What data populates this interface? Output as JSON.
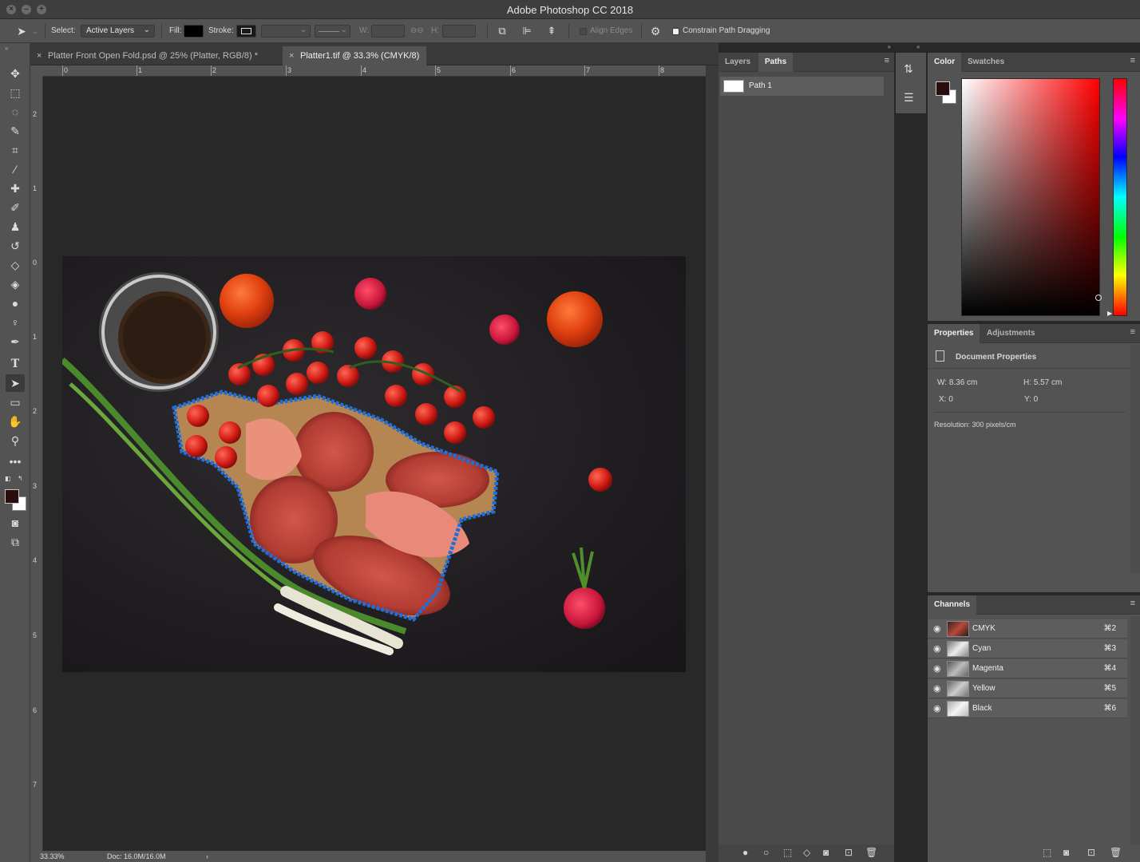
{
  "window": {
    "title": "Adobe Photoshop CC 2018"
  },
  "options_bar": {
    "select_label": "Select:",
    "select_value": "Active Layers",
    "fill_label": "Fill:",
    "stroke_label": "Stroke:",
    "w_label": "W:",
    "h_label": "H:",
    "align_edges_label": "Align Edges",
    "constrain_label": "Constrain Path Dragging"
  },
  "tabs": [
    {
      "label": "Platter Front Open Fold.psd @ 25% (Platter, RGB/8) *",
      "active": false
    },
    {
      "label": "Platter1.tif @ 33.3% (CMYK/8)",
      "active": true
    }
  ],
  "rulers": {
    "top_labels": [
      "0",
      "1",
      "2",
      "3",
      "4",
      "5",
      "6",
      "7",
      "8"
    ],
    "left_labels": [
      "2",
      "1",
      "0",
      "1",
      "2",
      "3",
      "4",
      "5",
      "6",
      "7"
    ]
  },
  "status": {
    "zoom": "33.33%",
    "doc": "Doc: 16.0M/16.0M",
    "arrow": "›"
  },
  "paths_panel": {
    "tabs": [
      "Layers",
      "Paths"
    ],
    "active_tab": "Paths",
    "items": [
      {
        "name": "Path 1"
      }
    ]
  },
  "color_panel": {
    "tabs": [
      "Color",
      "Swatches"
    ],
    "active_tab": "Color",
    "foreground": "#2b0d0d",
    "background": "#ffffff"
  },
  "properties_panel": {
    "tabs": [
      "Properties",
      "Adjustments"
    ],
    "active_tab": "Properties",
    "heading": "Document Properties",
    "w": "W:  8.36 cm",
    "h": "H:  5.57 cm",
    "x": "X:  0",
    "y": "Y:  0",
    "resolution": "Resolution: 300 pixels/cm"
  },
  "channels_panel": {
    "title": "Channels",
    "channels": [
      {
        "name": "CMYK",
        "shortcut": "⌘2"
      },
      {
        "name": "Cyan",
        "shortcut": "⌘3"
      },
      {
        "name": "Magenta",
        "shortcut": "⌘4"
      },
      {
        "name": "Yellow",
        "shortcut": "⌘5"
      },
      {
        "name": "Black",
        "shortcut": "⌘6"
      }
    ]
  },
  "colors": {
    "path_outline": "#1e6fd9",
    "ui_dark": "#282828",
    "ui_panel": "#535353"
  }
}
